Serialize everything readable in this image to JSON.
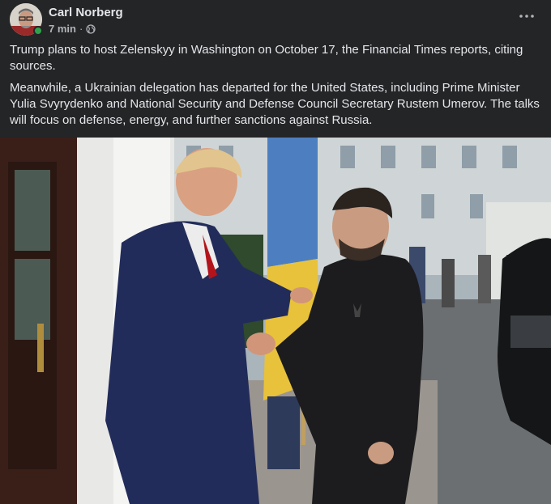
{
  "post": {
    "author": "Carl Norberg",
    "time": "7 min",
    "separator": "·",
    "privacy_icon": "globe-icon",
    "more_icon": "more-horizontal-icon",
    "paragraphs": [
      "Trump plans to host Zelenskyy in Washington on October 17, the Financial Times reports, citing sources.",
      "Meanwhile, a Ukrainian delegation has departed for the United States, including Prime Minister Yulia Svyrydenko and National Security and Defense Council Secretary Rustem Umerov. The talks will focus on defense, energy, and further sanctions against Russia."
    ]
  },
  "colors": {
    "background": "#242526",
    "text_primary": "#e4e6eb",
    "text_secondary": "#b0b3b8",
    "online": "#31a24c"
  }
}
